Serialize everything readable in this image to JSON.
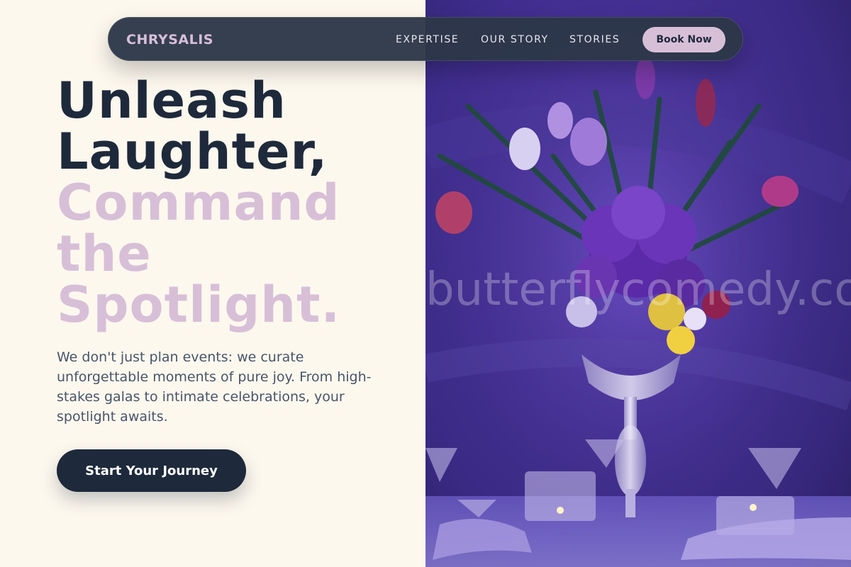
{
  "nav": {
    "brand": "CHRYSALIS",
    "links": [
      "EXPERTISE",
      "OUR STORY",
      "STORIES"
    ],
    "cta_label": "Book Now"
  },
  "hero": {
    "headline_dark": [
      "Unleash",
      "Laughter,"
    ],
    "headline_light": [
      "Command",
      "the",
      "Spotlight."
    ],
    "subtext": "We don't just plan events: we curate unforgettable moments of pure joy. From high-stakes galas to intimate celebrations, your spotlight awaits.",
    "cta_label": "Start Your Journey"
  },
  "image": {
    "watermark": "butterflycomedy.com",
    "description_icon": "floral-centerpiece-image"
  },
  "colors": {
    "accent": "#d8bfd8",
    "dark": "#1e293b",
    "background": "#fdf8ee",
    "nav_bg": "#2d3748"
  }
}
